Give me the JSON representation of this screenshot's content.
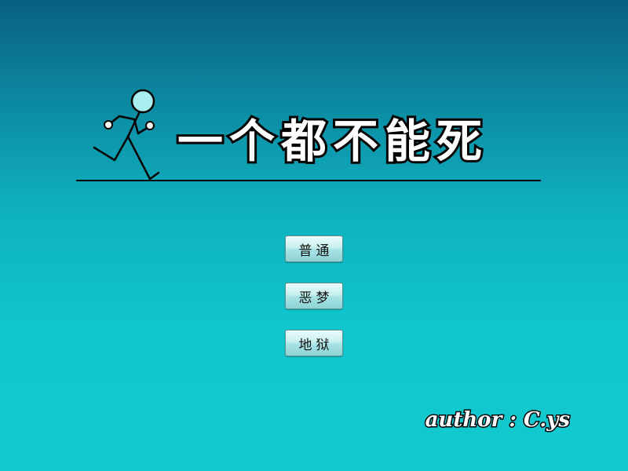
{
  "title": "一个都不能死",
  "menu": {
    "normal_label": "普通",
    "nightmare_label": "恶梦",
    "hell_label": "地狱"
  },
  "author_credit": "author : C.ys",
  "colors": {
    "background_top": "#0a5f80",
    "background_bottom": "#10cacf",
    "title_fill": "#ffffff",
    "title_outline": "#000000",
    "stickman_head": "#a8eef0"
  },
  "icons": {
    "logo": "running-stickman-icon"
  }
}
